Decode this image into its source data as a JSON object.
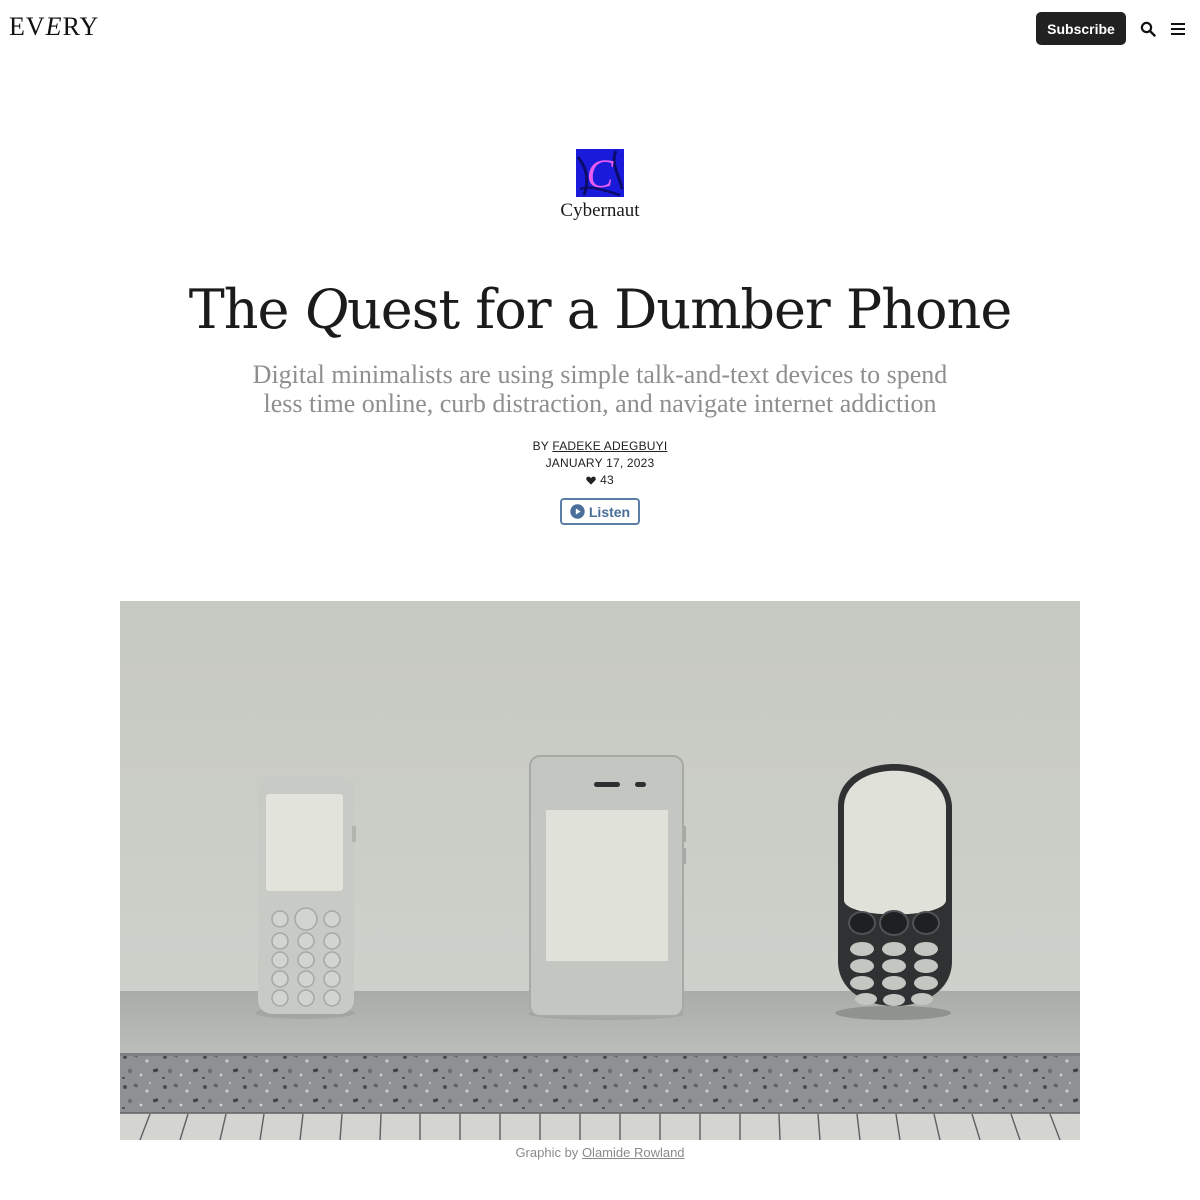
{
  "header": {
    "logo_left": "EV",
    "logo_mid": "E",
    "logo_right": "RY",
    "subscribe_label": "Subscribe",
    "icons": [
      "search-icon",
      "menu-icon"
    ]
  },
  "publication": {
    "logo_letter": "C",
    "name": "Cybernaut",
    "logo_colors": {
      "background": "#1a1adb",
      "letter": "#e85cf0"
    }
  },
  "article": {
    "title_before": "The ",
    "title_q": "Q",
    "title_after": "uest for a Dumber Phone",
    "subtitle": "Digital minimalists are using simple talk-and-text devices to spend less time online, curb distraction, and navigate internet addiction",
    "by_prefix": "BY",
    "author": "FADEKE ADEGBUYI",
    "date": "JANUARY 17, 2023",
    "likes": "43",
    "listen_label": "Listen"
  },
  "hero": {
    "caption_prefix": "Graphic by",
    "caption_author": "Olamide Rowland"
  },
  "colors": {
    "accent": "#5b7ea6",
    "button_dark": "#212121",
    "subtitle_gray": "#8e8e8e"
  }
}
